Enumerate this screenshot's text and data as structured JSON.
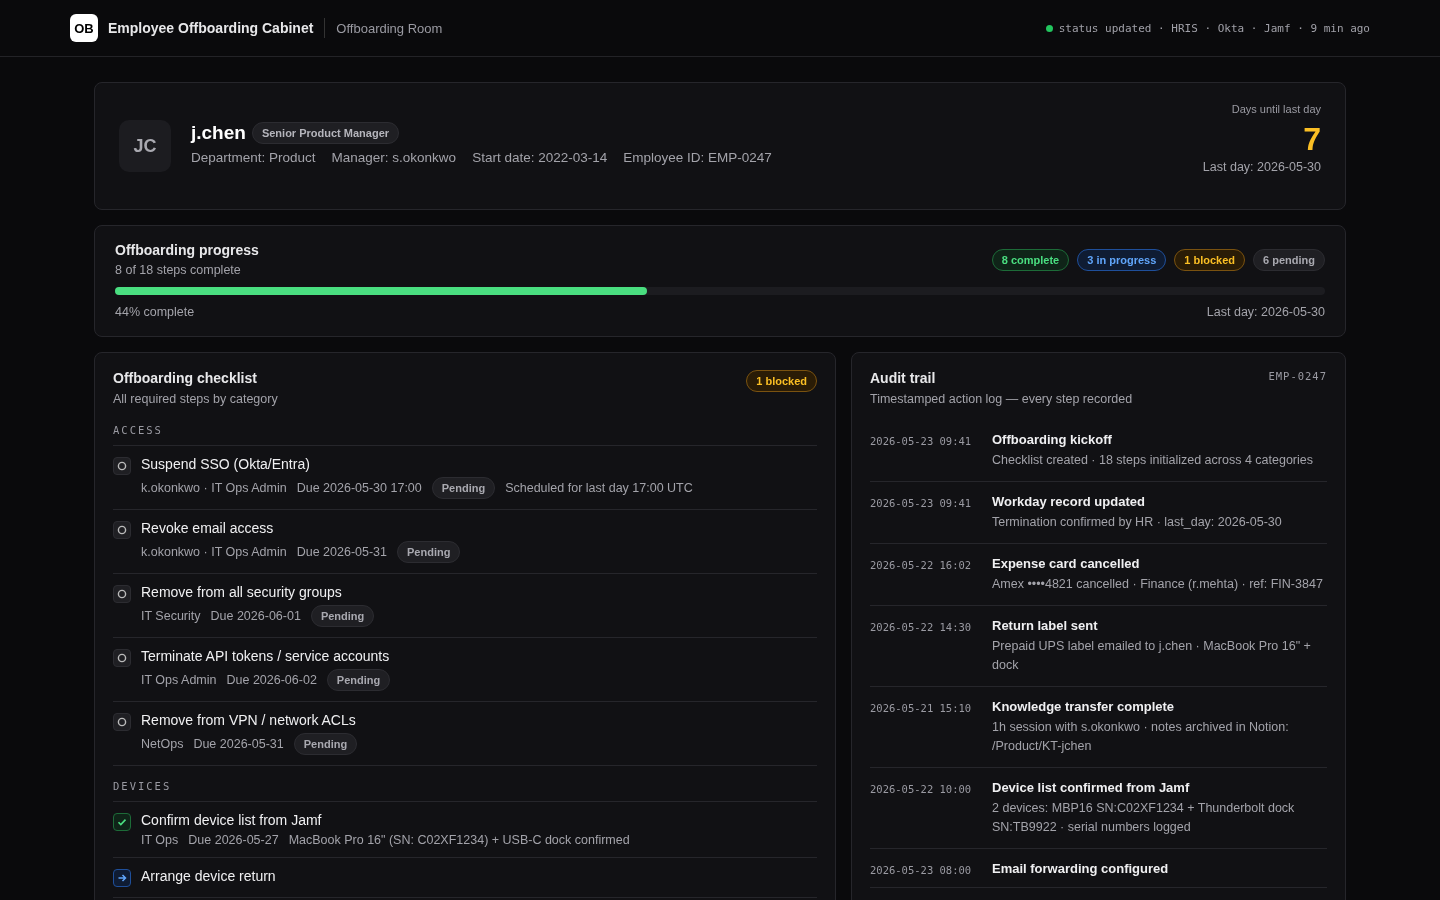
{
  "header": {
    "logo": "OB",
    "title": "Employee Offboarding Cabinet",
    "subtitle": "Offboarding Room",
    "status": {
      "online": true,
      "text": "status updated · HRIS · Okta · Jamf · 9 min ago"
    }
  },
  "profile": {
    "initials": "JC",
    "name": "j.chen",
    "role": "Senior Product Manager",
    "facts": [
      "Department: Product",
      "Manager: s.okonkwo",
      "Start date: 2022-03-14",
      "Employee ID: EMP-0247"
    ],
    "countdown_label": "Days until last day",
    "countdown": "7",
    "last_day": "Last day: 2026-05-30"
  },
  "progress": {
    "title": "Offboarding progress",
    "subtitle": "8 of 18 steps complete",
    "level": 0.44,
    "percent": "44% complete",
    "last_day": "Last day: 2026-05-30",
    "counts": [
      {
        "kind": "complete",
        "label": "8 complete"
      },
      {
        "kind": "in_progress",
        "label": "3 in progress"
      },
      {
        "kind": "blocked",
        "label": "1 blocked"
      },
      {
        "kind": "pending",
        "label": "6 pending"
      }
    ]
  },
  "checklist": {
    "title": "Offboarding checklist",
    "subtitle": "All required steps by category",
    "badge": {
      "kind": "blocked",
      "label": "1 blocked"
    },
    "sections": [
      {
        "name": "ACCESS",
        "items": [
          {
            "kind": "pending",
            "title": "Suspend SSO (Okta/Entra)",
            "owner": "k.okonkwo · IT Ops Admin",
            "due": "Due 2026-05-30 17:00",
            "badge": "Pending",
            "note": "Scheduled for last day 17:00 UTC"
          },
          {
            "kind": "pending",
            "title": "Revoke email access",
            "owner": "k.okonkwo · IT Ops Admin",
            "due": "Due 2026-05-31",
            "badge": "Pending"
          },
          {
            "kind": "pending",
            "title": "Remove from all security groups",
            "owner": "IT Security",
            "due": "Due 2026-06-01",
            "badge": "Pending"
          },
          {
            "kind": "pending",
            "title": "Terminate API tokens / service accounts",
            "owner": "IT Ops Admin",
            "due": "Due 2026-06-02",
            "badge": "Pending"
          },
          {
            "kind": "pending",
            "title": "Remove from VPN / network ACLs",
            "owner": "NetOps",
            "due": "Due 2026-05-31",
            "badge": "Pending"
          }
        ]
      },
      {
        "name": "DEVICES",
        "items": [
          {
            "kind": "done",
            "title": "Confirm device list from Jamf",
            "owner": "IT Ops",
            "due": "Due 2026-05-27",
            "note": "MacBook Pro 16\" (SN: C02XF1234) + USB-C dock confirmed"
          },
          {
            "kind": "in_progress",
            "title": "Arrange device return"
          }
        ]
      }
    ]
  },
  "audit": {
    "title": "Audit trail",
    "subtitle": "Timestamped action log — every step recorded",
    "ref": "EMP-0247",
    "entries": [
      {
        "time": "2026-05-23 09:41",
        "title": "Offboarding kickoff",
        "detail": "Checklist created · 18 steps initialized across 4 categories"
      },
      {
        "time": "2026-05-23 09:41",
        "title": "Workday record updated",
        "detail": "Termination confirmed by HR · last_day: 2026-05-30"
      },
      {
        "time": "2026-05-22 16:02",
        "title": "Expense card cancelled",
        "detail": "Amex ••••4821 cancelled · Finance (r.mehta) · ref: FIN-3847"
      },
      {
        "time": "2026-05-22 14:30",
        "title": "Return label sent",
        "detail": "Prepaid UPS label emailed to j.chen · MacBook Pro 16\" + dock"
      },
      {
        "time": "2026-05-21 15:10",
        "title": "Knowledge transfer complete",
        "detail": "1h session with s.okonkwo · notes archived in Notion: /Product/KT-jchen"
      },
      {
        "time": "2026-05-22 10:00",
        "title": "Device list confirmed from Jamf",
        "detail": "2 devices: MBP16 SN:C02XF1234 + Thunderbolt dock SN:TB9922 · serial numbers logged"
      },
      {
        "time": "2026-05-23 08:00",
        "title": "Email forwarding configured"
      }
    ]
  }
}
